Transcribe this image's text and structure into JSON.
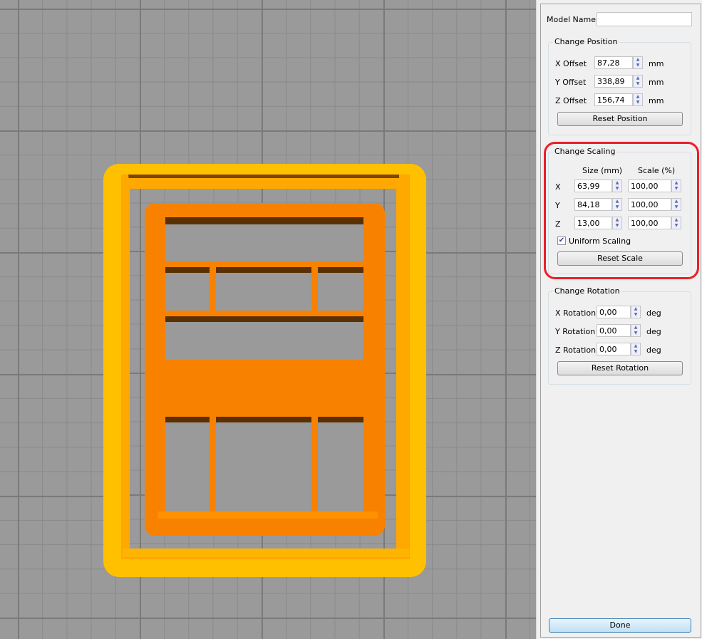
{
  "model_name": {
    "label": "Model Name:",
    "value": ""
  },
  "position": {
    "title": "Change Position",
    "unit": "mm",
    "rows": [
      {
        "label": "X Offset",
        "value": "87,28"
      },
      {
        "label": "Y Offset",
        "value": "338,89"
      },
      {
        "label": "Z Offset",
        "value": "156,74"
      }
    ],
    "reset": "Reset Position"
  },
  "scaling": {
    "title": "Change Scaling",
    "size_header": "Size (mm)",
    "scale_header": "Scale (%)",
    "rows": [
      {
        "label": "X",
        "size": "63,99",
        "scale": "100,00"
      },
      {
        "label": "Y",
        "size": "84,18",
        "scale": "100,00"
      },
      {
        "label": "Z",
        "size": "13,00",
        "scale": "100,00"
      }
    ],
    "uniform": "Uniform Scaling",
    "uniform_checked": true,
    "reset": "Reset Scale"
  },
  "rotation": {
    "title": "Change Rotation",
    "unit": "deg",
    "rows": [
      {
        "label": "X Rotation",
        "value": "0,00"
      },
      {
        "label": "Y Rotation",
        "value": "0,00"
      },
      {
        "label": "Z Rotation",
        "value": "0,00"
      }
    ],
    "reset": "Reset Rotation"
  },
  "done": "Done",
  "colors": {
    "outer": "#ffc000",
    "inner": "#f88200",
    "highlight": "#e8202a"
  }
}
